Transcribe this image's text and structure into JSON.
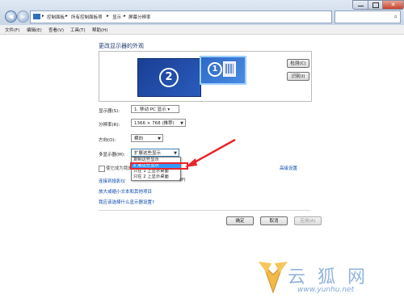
{
  "address_bar": {
    "breadcrumbs": [
      "控制面板",
      "所有控制面板项",
      "显示",
      "屏幕分辨率"
    ],
    "separator": "▸"
  },
  "menubar": {
    "items": [
      "文件(F)",
      "编辑(E)",
      "查看(V)",
      "工具(T)",
      "帮助(H)"
    ]
  },
  "page": {
    "title": "更改显示器的外观"
  },
  "preview": {
    "monitor_2_number": "2",
    "monitor_1_number": "1",
    "detect_button": "检测(C)",
    "identify_button": "识别(I)"
  },
  "form": {
    "display_label": "显示器(S):",
    "display_value": "1. 移动 PC 显示 ▾",
    "resolution_label": "分辨率(R):",
    "resolution_value": "1366 × 768 (推荐)",
    "orientation_label": "方向(O):",
    "orientation_value": "横向",
    "multi_display_label": "多显示器(M):",
    "multi_display_value": "扩展这些显示",
    "checkbox_label": "使它成为我的",
    "advanced_link": "高级设置"
  },
  "dropdown": {
    "options": [
      "复制这些显示",
      "扩展这些显示",
      "只在 1 上显示桌面",
      "只在 2 上显示桌面"
    ],
    "selected_index": 1
  },
  "links": {
    "projector": "连接到投影仪",
    "projector_suffix": "(P)",
    "text_size": "放大或缩小文本和其他项目",
    "which_settings": "我应该选择什么显示器设置?"
  },
  "footer": {
    "ok": "确定",
    "cancel": "取消",
    "apply": "应用(A)"
  },
  "watermark": {
    "brand": "云 狐 网",
    "url": "www.yunhu.net"
  },
  "colors": {
    "accent_red": "#e8262b",
    "monitor_blue": "#1f4aa3",
    "selection_blue": "#3399ff"
  },
  "icons": [
    "back-arrow-icon",
    "forward-arrow-icon",
    "control-panel-icon",
    "search-icon",
    "minimize-icon",
    "maximize-icon",
    "close-icon",
    "arrow-annotation-icon",
    "fox-logo-icon"
  ]
}
